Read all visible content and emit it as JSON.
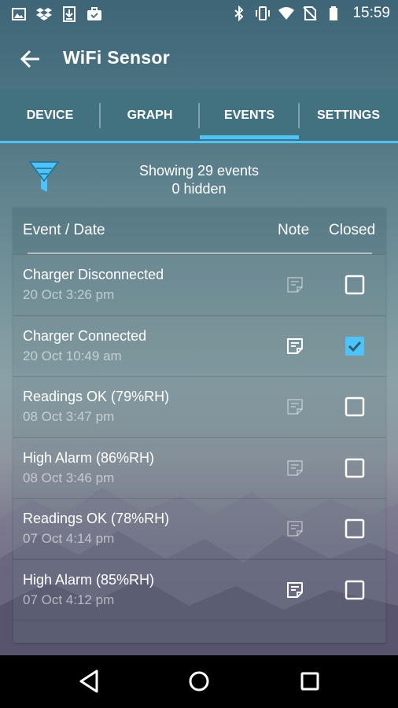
{
  "status_bar": {
    "time": "15:59",
    "left_icons": [
      "image-icon",
      "dropbox-icon",
      "download-icon",
      "briefcase-check-icon"
    ],
    "right_icons": [
      "bluetooth-icon",
      "vibrate-icon",
      "wifi-icon",
      "no-sim-icon",
      "battery-icon"
    ]
  },
  "app_bar": {
    "title": "WiFi Sensor",
    "back_icon": "arrow-back-icon"
  },
  "tabs": [
    {
      "label": "DEVICE",
      "active": false
    },
    {
      "label": "GRAPH",
      "active": false
    },
    {
      "label": "EVENTS",
      "active": true
    },
    {
      "label": "SETTINGS",
      "active": false
    }
  ],
  "accent_color": "#4fc3f7",
  "summary": {
    "line1": "Showing 29 events",
    "line2": "0 hidden"
  },
  "table": {
    "headers": {
      "event": "Event / Date",
      "note": "Note",
      "closed": "Closed"
    },
    "rows": [
      {
        "event": "Charger Disconnected",
        "date": "20 Oct 3:26 pm",
        "has_note": false,
        "closed": false
      },
      {
        "event": "Charger Connected",
        "date": "20 Oct 10:49 am",
        "has_note": true,
        "closed": true
      },
      {
        "event": "Readings OK (79%RH)",
        "date": "08 Oct 3:47 pm",
        "has_note": false,
        "closed": false
      },
      {
        "event": "High Alarm (86%RH)",
        "date": "08 Oct 3:46 pm",
        "has_note": false,
        "closed": false
      },
      {
        "event": "Readings OK (78%RH)",
        "date": "07 Oct 4:14 pm",
        "has_note": false,
        "closed": false
      },
      {
        "event": "High Alarm (85%RH)",
        "date": "07 Oct 4:12 pm",
        "has_note": true,
        "closed": false
      }
    ]
  },
  "nav_bar": {
    "icons": [
      "back-triangle-icon",
      "home-circle-icon",
      "recents-square-icon"
    ]
  }
}
